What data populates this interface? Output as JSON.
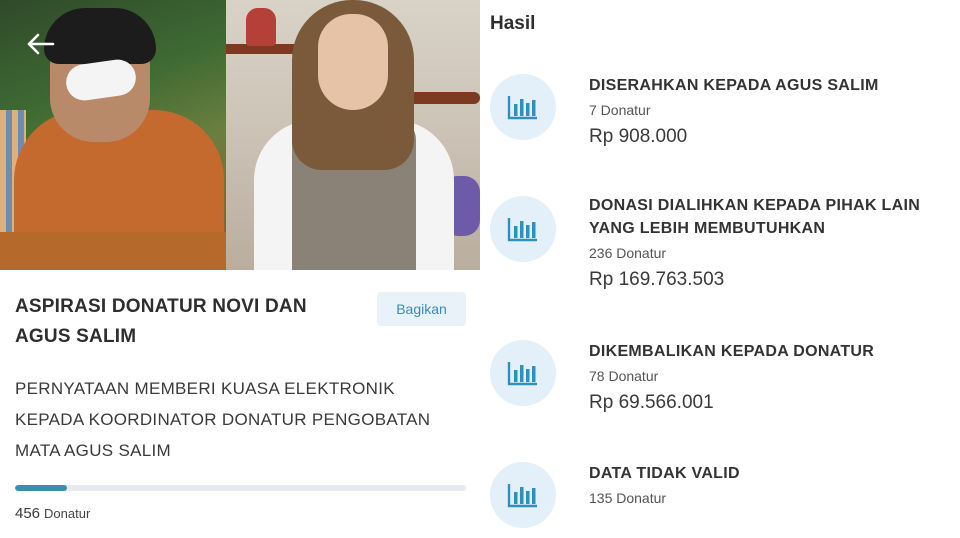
{
  "campaign": {
    "title": "ASPIRASI DONATUR NOVI DAN AGUS SALIM",
    "share_label": "Bagikan",
    "description": "PERNYATAAN MEMBERI KUASA ELEKTRONIK KEPADA KOORDINATOR DONATUR PENGOBATAN MATA AGUS SALIM",
    "progress_fraction": 0.115,
    "donor_count": "456",
    "donor_label": "Donatur",
    "accent_color": "#3b8fae",
    "back_icon": "arrow-left-icon"
  },
  "results": {
    "heading": "Hasil",
    "items": [
      {
        "title": "DISERAHKAN KEPADA AGUS SALIM",
        "count": "7 Donatur",
        "amount": "Rp 908.000",
        "icon": "bar-chart-icon"
      },
      {
        "title": "DONASI DIALIHKAN KEPADA PIHAK LAIN YANG LEBIH MEMBUTUHKAN",
        "count": "236 Donatur",
        "amount": "Rp 169.763.503",
        "icon": "bar-chart-icon"
      },
      {
        "title": "DIKEMBALIKAN KEPADA DONATUR",
        "count": "78 Donatur",
        "amount": "Rp 69.566.001",
        "icon": "bar-chart-icon"
      },
      {
        "title": "DATA TIDAK VALID",
        "count": "135 Donatur",
        "amount": "",
        "icon": "bar-chart-icon"
      }
    ]
  }
}
